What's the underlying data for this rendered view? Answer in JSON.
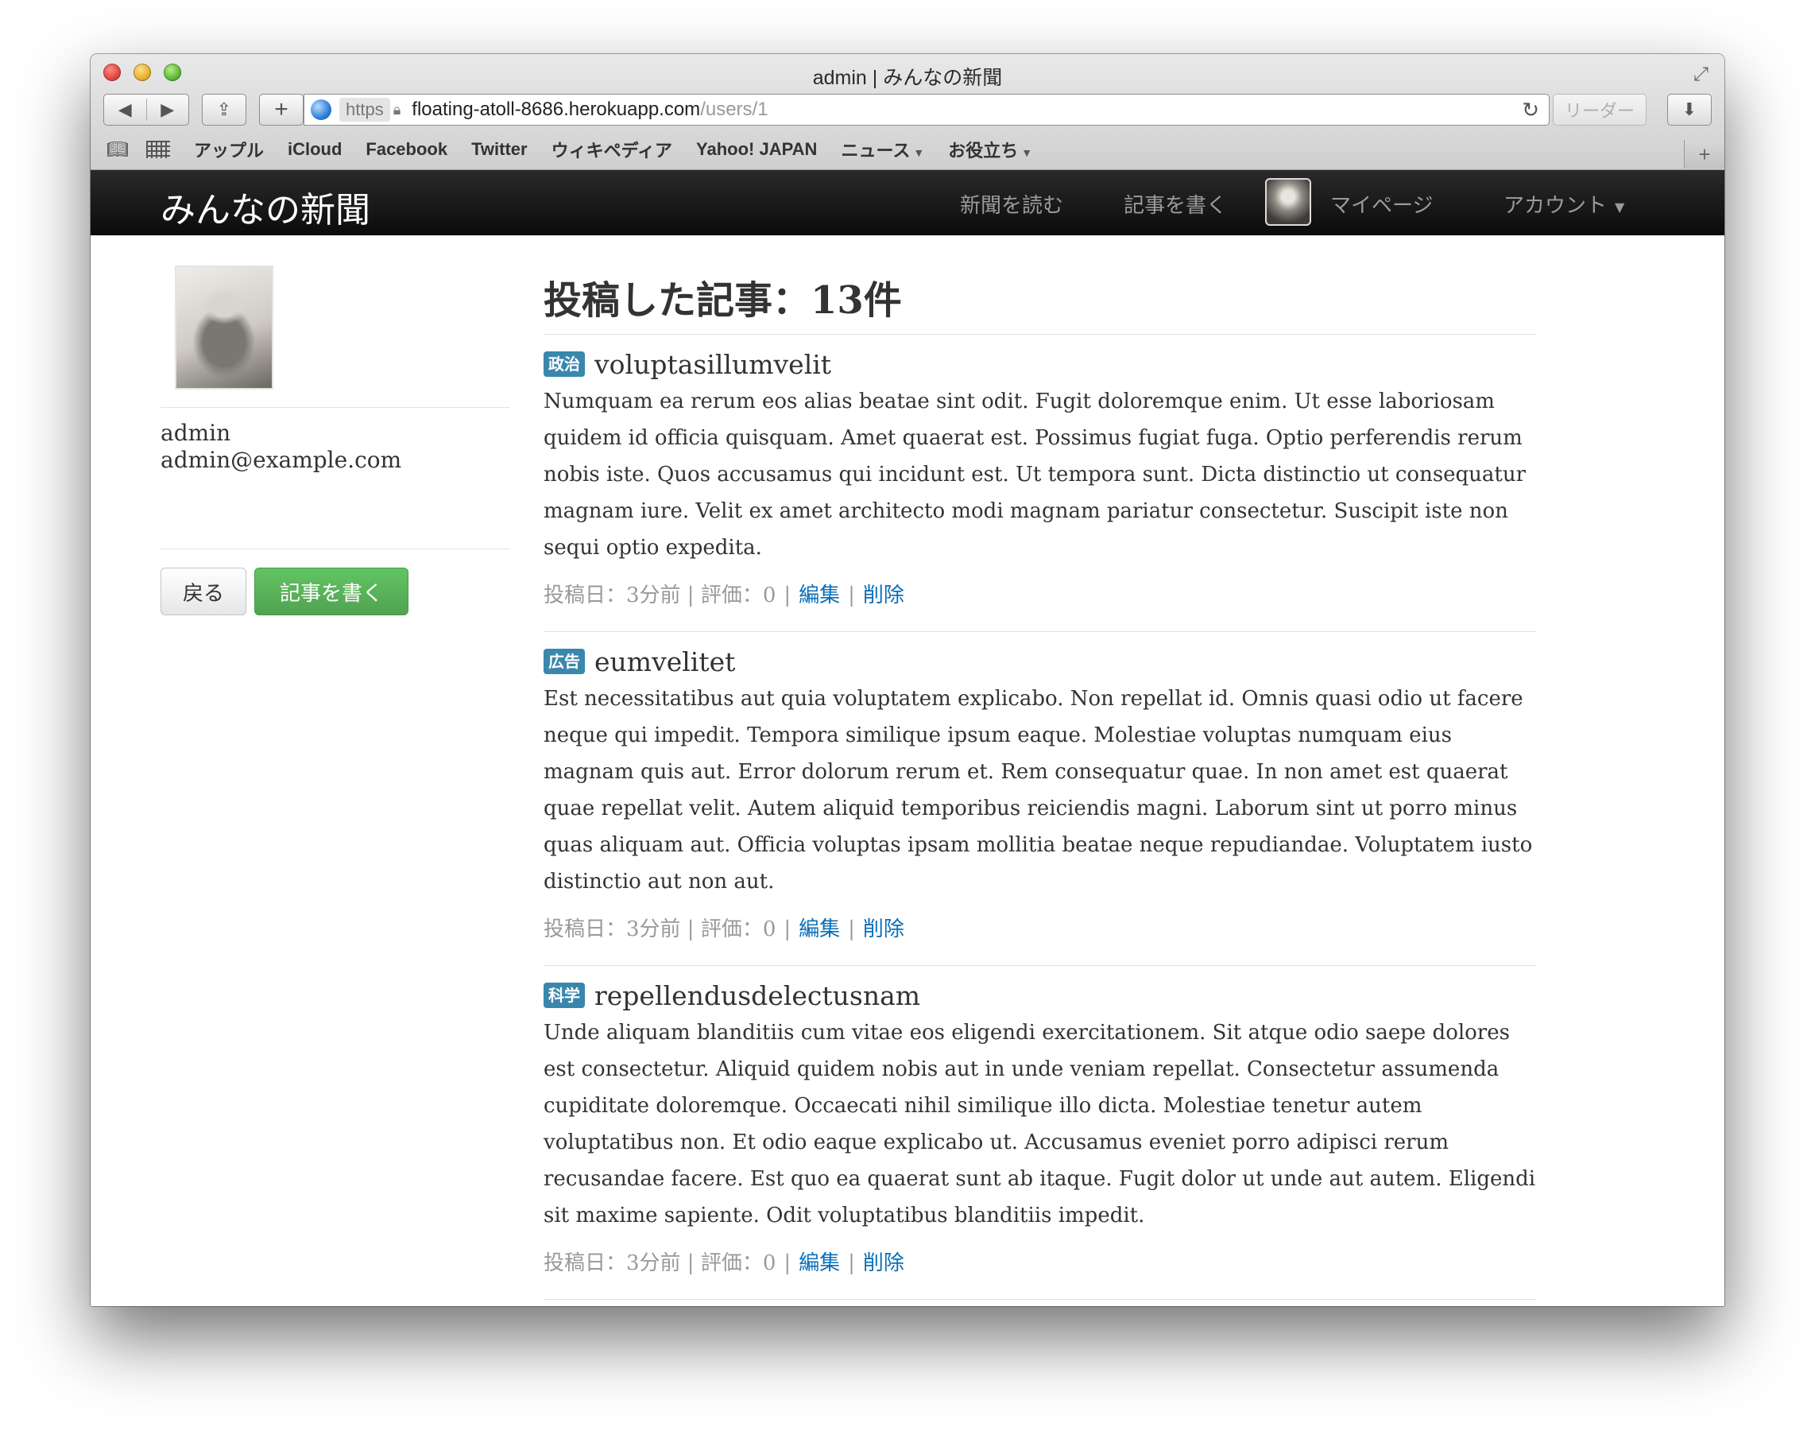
{
  "browser": {
    "window_title": "admin | みんなの新聞",
    "url_scheme": "https",
    "url_host": "floating-atoll-8686.herokuapp.com",
    "url_path": "/users/1",
    "reader_label": "リーダー",
    "bookmarks": [
      {
        "label": "アップル",
        "dropdown": false
      },
      {
        "label": "iCloud",
        "dropdown": false
      },
      {
        "label": "Facebook",
        "dropdown": false
      },
      {
        "label": "Twitter",
        "dropdown": false
      },
      {
        "label": "ウィキペディア",
        "dropdown": false
      },
      {
        "label": "Yahoo! JAPAN",
        "dropdown": false
      },
      {
        "label": "ニュース",
        "dropdown": true
      },
      {
        "label": "お役立ち",
        "dropdown": true
      }
    ]
  },
  "navbar": {
    "brand": "みんなの新聞",
    "read_label": "新聞を読む",
    "write_label": "記事を書く",
    "mypage_label": "マイページ",
    "account_label": "アカウント"
  },
  "sidebar": {
    "username": "admin",
    "email": "admin@example.com",
    "back_button": "戻る",
    "write_button": "記事を書く"
  },
  "main": {
    "heading": "投稿した記事：13件",
    "articles": [
      {
        "category": "政治",
        "title": "voluptasillumvelit",
        "body": "Numquam ea rerum eos alias beatae sint odit. Fugit doloremque enim. Ut esse laboriosam quidem id officia quisquam. Amet quaerat est. Possimus fugiat fuga. Optio perferendis rerum nobis iste. Quos accusamus qui incidunt est. Ut tempora sunt. Dicta distinctio ut consequatur magnam iure. Velit ex amet architecto modi magnam pariatur consectetur. Suscipit iste non sequi optio expedita.",
        "meta": "投稿日：3分前 | 評価：0",
        "edit": "編集",
        "delete": "削除"
      },
      {
        "category": "広告",
        "title": "eumvelitet",
        "body": "Est necessitatibus aut quia voluptatem explicabo. Non repellat id. Omnis quasi odio ut facere neque qui impedit. Tempora similique ipsum eaque. Molestiae voluptas numquam eius magnam quis aut. Error dolorum rerum et. Rem consequatur quae. In non amet est quaerat quae repellat velit. Autem aliquid temporibus reiciendis magni. Laborum sint ut porro minus quas aliquam aut. Officia voluptas ipsam mollitia beatae neque repudiandae. Voluptatem iusto distinctio aut non aut.",
        "meta": "投稿日：3分前 | 評価：0",
        "edit": "編集",
        "delete": "削除"
      },
      {
        "category": "科学",
        "title": "repellendusdelectusnam",
        "body": "Unde aliquam blanditiis cum vitae eos eligendi exercitationem. Sit atque odio saepe dolores est consectetur. Aliquid quidem nobis aut in unde veniam repellat. Consectetur assumenda cupiditate doloremque. Occaecati nihil similique illo dicta. Molestiae tenetur autem voluptatibus non. Et odio eaque explicabo ut. Accusamus eveniet porro adipisci rerum recusandae facere. Est quo ea quaerat sunt ab itaque. Fugit dolor ut unde aut autem. Eligendi sit maxime sapiente. Odit voluptatibus blanditiis impedit.",
        "meta": "投稿日：3分前 | 評価：0",
        "edit": "編集",
        "delete": "削除"
      }
    ]
  },
  "colors": {
    "label_bg": "#3a87ad",
    "link": "#0a6fb8",
    "success_button": "#5bb75b",
    "navbar_bg": "#1b1b1b"
  }
}
